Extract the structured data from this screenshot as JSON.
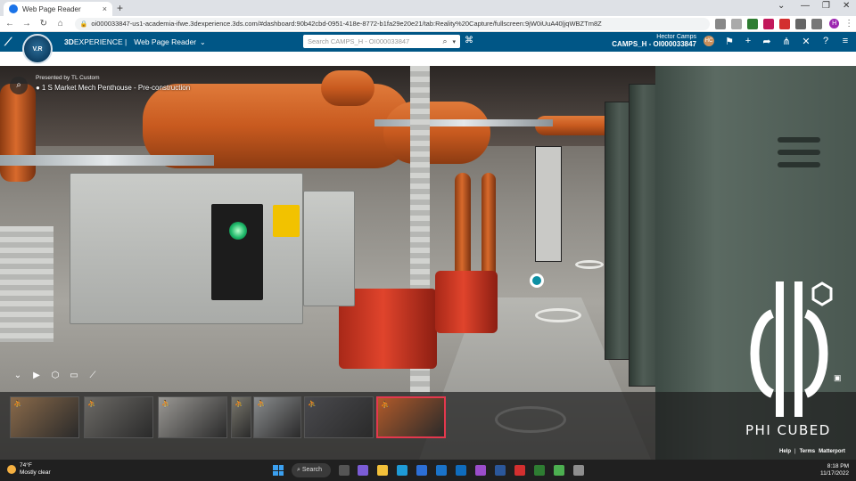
{
  "browser": {
    "tab_title": "Web Page Reader",
    "tab_close": "×",
    "new_tab": "+",
    "url": "oi000033847-us1-academia-ifwe.3dexperience.3ds.com/#dashboard:90b42cbd-0951-418e-8772-b1fa29e20e21/tab:Reality%20Capture/fullscreen:9jW0iUuA40|jqWBZTm8Z",
    "window_controls": [
      "⌄",
      "—",
      "❐",
      "✕"
    ],
    "profile_initial": "H"
  },
  "app_header": {
    "brand_prefix": "3D",
    "brand_name": "EXPERIENCE",
    "app_name": "Web Page Reader",
    "compass_label": "V.R",
    "search_placeholder": "Search CAMPS_H - OI000033847",
    "user_name": "Hector Camps",
    "tenant": "CAMPS_H - OI000033847",
    "avatar_initials": "HC",
    "icons": [
      "tag-icon",
      "bell-icon",
      "plus-icon",
      "share-icon",
      "network-icon",
      "tools-icon",
      "help-icon",
      "menu-icon"
    ]
  },
  "viewer": {
    "presented_by": "Presented by TL Custom",
    "model_title": "1 S Market Mech Penthouse - Pre-construction",
    "toolbar": [
      "chevron-down-icon",
      "play-icon",
      "dollhouse-icon",
      "floorplan-icon",
      "measure-icon"
    ],
    "thumbnails": [
      {
        "label": "scan-1",
        "active": false,
        "color": "#8a6a4a"
      },
      {
        "label": "scan-2",
        "active": false,
        "color": "#6c6a66"
      },
      {
        "label": "scan-3",
        "active": false,
        "color": "#9a9894"
      },
      {
        "label": "scan-4",
        "active": false,
        "color": "#7a786e"
      },
      {
        "label": "scan-5",
        "active": false,
        "color": "#8a8c8e"
      },
      {
        "label": "dollhouse",
        "active": false,
        "color": "#4a4a4e"
      },
      {
        "label": "scan-7",
        "active": true,
        "color": "#b05a2a"
      }
    ],
    "watermark_text": "PHI CUBED",
    "footer_help": "Help",
    "footer_sep": "|",
    "footer_terms": "Terms",
    "footer_brand": "Matterport"
  },
  "taskbar": {
    "temperature": "74°F",
    "weather": "Mostly clear",
    "search_label": "Search",
    "time": "8:18 PM",
    "date": "11/17/2022"
  },
  "colors": {
    "header_blue": "#005686",
    "active_thumb": "#e4384d",
    "nav_marker": "#0c8fa3"
  }
}
